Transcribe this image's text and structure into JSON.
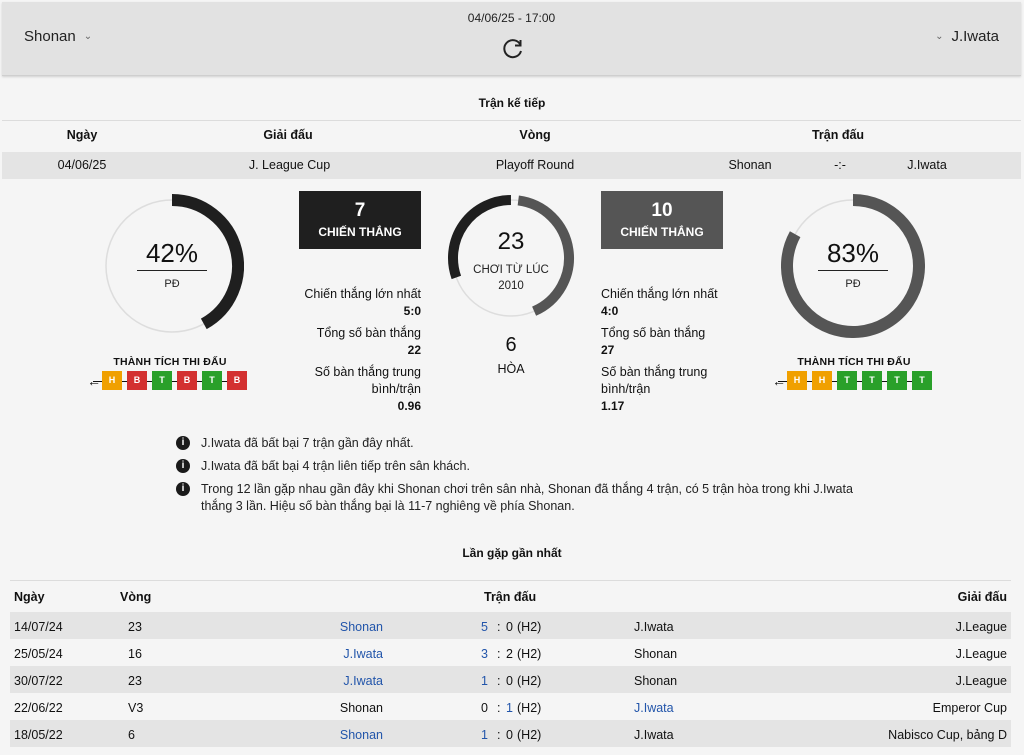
{
  "header": {
    "home_team": "Shonan",
    "away_team": "J.Iwata",
    "datetime": "04/06/25 - 17:00",
    "refresh_icon": "refresh-icon",
    "chevron_icon": "chevron-down-icon"
  },
  "next_match": {
    "title": "Trận kế tiếp",
    "columns": [
      "Ngày",
      "Giải đấu",
      "Vòng",
      "Trận đấu"
    ],
    "row": {
      "date": "04/06/25",
      "league": "J. League Cup",
      "round": "Playoff Round",
      "home": "Shonan",
      "score": "-:-",
      "away": "J.Iwata"
    }
  },
  "summary": {
    "home": {
      "pct": "42%",
      "pct_value": 42,
      "pct_label": "PĐ",
      "wins": "7",
      "wins_label": "CHIẾN THẮNG",
      "biggest_win_label": "Chiến thắng lớn nhất",
      "biggest_win": "5:0",
      "total_goals_label": "Tổng số bàn thắng",
      "total_goals": "22",
      "avg_goals_label": "Số bàn thắng trung bình/trận",
      "avg_goals": "0.96",
      "form_title": "THÀNH TÍCH THI ĐẤU",
      "form": [
        "H",
        "B",
        "T",
        "B",
        "T",
        "B"
      ]
    },
    "away": {
      "pct": "83%",
      "pct_value": 83,
      "pct_label": "PĐ",
      "wins": "10",
      "wins_label": "CHIẾN THẮNG",
      "biggest_win_label": "Chiến thắng lớn nhất",
      "biggest_win": "4:0",
      "total_goals_label": "Tổng số bàn thắng",
      "total_goals": "27",
      "avg_goals_label": "Số bàn thắng trung bình/trận",
      "avg_goals": "1.17",
      "form_title": "THÀNH TÍCH THI ĐẤU",
      "form": [
        "H",
        "H",
        "T",
        "T",
        "T",
        "T"
      ]
    },
    "total_played": "23",
    "played_since_label": "CHƠI TỪ LÚC",
    "played_since_year": "2010",
    "draws": "6",
    "draws_label": "HÒA",
    "colors": {
      "home": "#1f1f1f",
      "away": "#555555",
      "track": "#dddddd"
    }
  },
  "notes": [
    "J.Iwata đã bất bại 7 trận gần đây nhất.",
    "J.Iwata đã bất bại 4 trận liên tiếp trên sân khách.",
    "Trong 12 lần gặp nhau gần đây khi Shonan chơi trên sân nhà, Shonan đã thắng 4 trận, có 5 trận hòa trong khi J.Iwata thắng 3 lần. Hiệu số bàn thắng bại là 11-7 nghiêng về phía Shonan."
  ],
  "h2h": {
    "title": "Lần gặp gần nhất",
    "columns": {
      "date": "Ngày",
      "round": "Vòng",
      "match": "Trận đấu",
      "league": "Giải đấu"
    },
    "rows": [
      {
        "date": "14/07/24",
        "round": "23",
        "home": "Shonan",
        "home_link": true,
        "hs": "5",
        "as": "0",
        "hs_link": true,
        "as_link": false,
        "note": "(H2)",
        "away": "J.Iwata",
        "away_link": false,
        "league": "J.League"
      },
      {
        "date": "25/05/24",
        "round": "16",
        "home": "J.Iwata",
        "home_link": true,
        "hs": "3",
        "as": "2",
        "hs_link": true,
        "as_link": false,
        "note": "(H2)",
        "away": "Shonan",
        "away_link": false,
        "league": "J.League"
      },
      {
        "date": "30/07/22",
        "round": "23",
        "home": "J.Iwata",
        "home_link": true,
        "hs": "1",
        "as": "0",
        "hs_link": true,
        "as_link": false,
        "note": "(H2)",
        "away": "Shonan",
        "away_link": false,
        "league": "J.League"
      },
      {
        "date": "22/06/22",
        "round": "V3",
        "home": "Shonan",
        "home_link": false,
        "hs": "0",
        "as": "1",
        "hs_link": false,
        "as_link": true,
        "note": "(H2)",
        "away": "J.Iwata",
        "away_link": true,
        "league": "Emperor Cup"
      },
      {
        "date": "18/05/22",
        "round": "6",
        "home": "Shonan",
        "home_link": true,
        "hs": "1",
        "as": "0",
        "hs_link": true,
        "as_link": false,
        "note": "(H2)",
        "away": "J.Iwata",
        "away_link": false,
        "league": "Nabisco Cup, bảng D"
      }
    ]
  }
}
